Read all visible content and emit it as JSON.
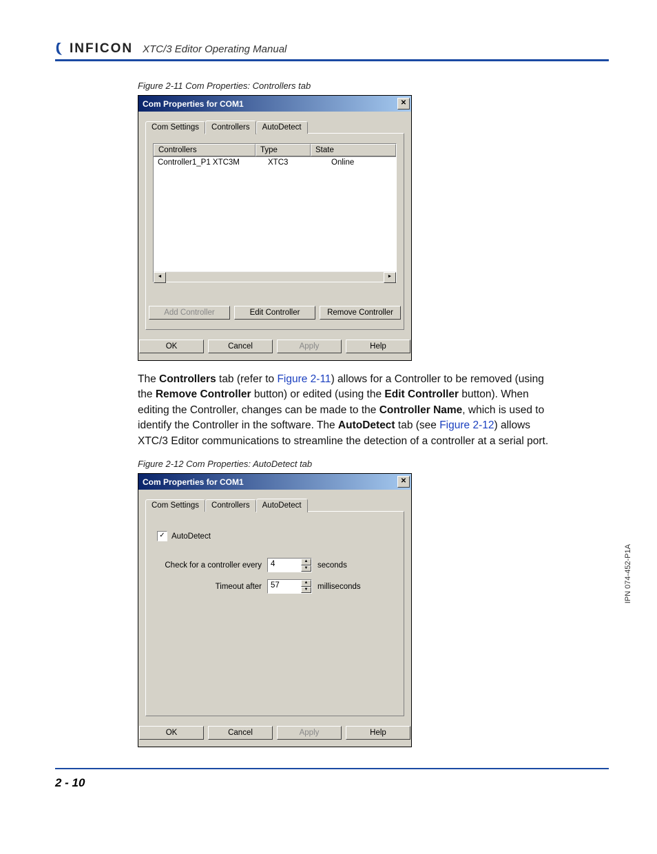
{
  "header": {
    "brand": "INFICON",
    "manual_title": "XTC/3 Editor Operating Manual"
  },
  "fig211": {
    "caption": "Figure 2-11  Com Properties: Controllers tab",
    "dialog_title": "Com Properties for COM1",
    "tabs": {
      "com_settings": "Com Settings",
      "controllers": "Controllers",
      "autodetect": "AutoDetect"
    },
    "list": {
      "headers": {
        "controllers": "Controllers",
        "type": "Type",
        "state": "State"
      },
      "row1": {
        "controllers": "Controller1_P1 XTC3M",
        "type": "XTC3",
        "state": "Online"
      }
    },
    "buttons": {
      "add": "Add Controller",
      "edit": "Edit Controller",
      "remove": "Remove Controller",
      "ok": "OK",
      "cancel": "Cancel",
      "apply": "Apply",
      "help": "Help"
    }
  },
  "para": {
    "t1": "The ",
    "b1": "Controllers",
    "t2": " tab (refer to ",
    "l1": "Figure 2-11",
    "t3": ") allows for a Controller to be removed (using the ",
    "b2": "Remove Controller",
    "t4": " button) or edited (using the ",
    "b3": "Edit Controller",
    "t5": " button). When editing the Controller, changes can be made to the ",
    "b4": "Controller Name",
    "t6": ", which is used to identify the Controller in the software. The ",
    "b5": "AutoDetect",
    "t7": " tab (see ",
    "l2": "Figure 2-12",
    "t8": ") allows XTC/3 Editor communications to streamline the detection of a controller at a serial port."
  },
  "fig212": {
    "caption": "Figure 2-12  Com Properties: AutoDetect tab",
    "dialog_title": "Com Properties for COM1",
    "tabs": {
      "com_settings": "Com Settings",
      "controllers": "Controllers",
      "autodetect": "AutoDetect"
    },
    "autodetect_label": "AutoDetect",
    "check_label": "Check for a controller every",
    "check_value": "4",
    "check_unit": "seconds",
    "timeout_label": "Timeout after",
    "timeout_value": "57",
    "timeout_unit": "milliseconds",
    "buttons": {
      "ok": "OK",
      "cancel": "Cancel",
      "apply": "Apply",
      "help": "Help"
    }
  },
  "side": {
    "ipn": "IPN 074-452-P1A"
  },
  "footer": {
    "page": "2 - 10"
  }
}
